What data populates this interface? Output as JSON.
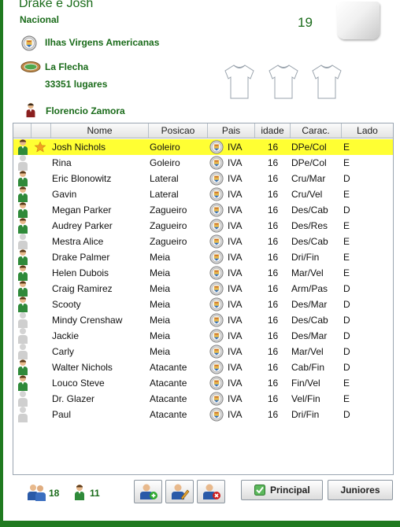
{
  "header": {
    "team_name": "Drake e Josh",
    "division": "Nacional",
    "score": "19",
    "country": "Ilhas Virgens Americanas",
    "stadium": "La Flecha",
    "capacity": "33351 lugares",
    "coach": "Florencio Zamora"
  },
  "table": {
    "columns": [
      "Nome",
      "Posicao",
      "Pais",
      "idade",
      "Carac.",
      "Lado"
    ],
    "rows": [
      {
        "nome": "Josh Nichols",
        "posicao": "Goleiro",
        "pais": "IVA",
        "idade": "16",
        "carac": "DPe/Col",
        "lado": "E",
        "active": true,
        "star": true,
        "selected": true
      },
      {
        "nome": "Rina",
        "posicao": "Goleiro",
        "pais": "IVA",
        "idade": "16",
        "carac": "DPe/Col",
        "lado": "E",
        "active": false,
        "star": false,
        "selected": false
      },
      {
        "nome": "Eric Blonowitz",
        "posicao": "Lateral",
        "pais": "IVA",
        "idade": "16",
        "carac": "Cru/Mar",
        "lado": "D",
        "active": true,
        "star": false,
        "selected": false
      },
      {
        "nome": "Gavin",
        "posicao": "Lateral",
        "pais": "IVA",
        "idade": "16",
        "carac": "Cru/Vel",
        "lado": "E",
        "active": true,
        "star": false,
        "selected": false
      },
      {
        "nome": "Megan Parker",
        "posicao": "Zagueiro",
        "pais": "IVA",
        "idade": "16",
        "carac": "Des/Cab",
        "lado": "D",
        "active": true,
        "star": false,
        "selected": false
      },
      {
        "nome": "Audrey Parker",
        "posicao": "Zagueiro",
        "pais": "IVA",
        "idade": "16",
        "carac": "Des/Res",
        "lado": "E",
        "active": true,
        "star": false,
        "selected": false
      },
      {
        "nome": "Mestra Alice",
        "posicao": "Zagueiro",
        "pais": "IVA",
        "idade": "16",
        "carac": "Des/Cab",
        "lado": "E",
        "active": false,
        "star": false,
        "selected": false
      },
      {
        "nome": "Drake Palmer",
        "posicao": "Meia",
        "pais": "IVA",
        "idade": "16",
        "carac": "Dri/Fin",
        "lado": "E",
        "active": true,
        "star": false,
        "selected": false
      },
      {
        "nome": "Helen Dubois",
        "posicao": "Meia",
        "pais": "IVA",
        "idade": "16",
        "carac": "Mar/Vel",
        "lado": "E",
        "active": true,
        "star": false,
        "selected": false
      },
      {
        "nome": "Craig Ramirez",
        "posicao": "Meia",
        "pais": "IVA",
        "idade": "16",
        "carac": "Arm/Pas",
        "lado": "D",
        "active": true,
        "star": false,
        "selected": false
      },
      {
        "nome": "Scooty",
        "posicao": "Meia",
        "pais": "IVA",
        "idade": "16",
        "carac": "Des/Mar",
        "lado": "D",
        "active": true,
        "star": false,
        "selected": false
      },
      {
        "nome": "Mindy Crenshaw",
        "posicao": "Meia",
        "pais": "IVA",
        "idade": "16",
        "carac": "Des/Cab",
        "lado": "D",
        "active": false,
        "star": false,
        "selected": false
      },
      {
        "nome": "Jackie",
        "posicao": "Meia",
        "pais": "IVA",
        "idade": "16",
        "carac": "Des/Mar",
        "lado": "D",
        "active": false,
        "star": false,
        "selected": false
      },
      {
        "nome": "Carly",
        "posicao": "Meia",
        "pais": "IVA",
        "idade": "16",
        "carac": "Mar/Vel",
        "lado": "D",
        "active": false,
        "star": false,
        "selected": false
      },
      {
        "nome": "Walter Nichols",
        "posicao": "Atacante",
        "pais": "IVA",
        "idade": "16",
        "carac": "Cab/Fin",
        "lado": "D",
        "active": true,
        "star": false,
        "selected": false
      },
      {
        "nome": "Louco Steve",
        "posicao": "Atacante",
        "pais": "IVA",
        "idade": "16",
        "carac": "Fin/Vel",
        "lado": "E",
        "active": true,
        "star": false,
        "selected": false
      },
      {
        "nome": "Dr. Glazer",
        "posicao": "Atacante",
        "pais": "IVA",
        "idade": "16",
        "carac": "Vel/Fin",
        "lado": "E",
        "active": false,
        "star": false,
        "selected": false
      },
      {
        "nome": "Paul",
        "posicao": "Atacante",
        "pais": "IVA",
        "idade": "16",
        "carac": "Dri/Fin",
        "lado": "D",
        "active": false,
        "star": false,
        "selected": false
      }
    ]
  },
  "footer": {
    "squad_count": "18",
    "starters_count": "11",
    "principal_label": "Principal",
    "juniores_label": "Juniores"
  },
  "colors": {
    "accent_green": "#1a6b1a",
    "selected_row": "#ffff33",
    "star": "#f0a020"
  },
  "icons": {
    "country": "flag-seal-icon",
    "stadium": "stadium-icon",
    "coach": "coach-icon",
    "kit": "jersey-icon",
    "player_active": "player-active-icon",
    "player_inactive": "player-inactive-icon",
    "captain": "star-icon",
    "add": "add-player-icon",
    "edit": "edit-player-icon",
    "remove": "remove-player-icon",
    "principal": "check-icon"
  }
}
